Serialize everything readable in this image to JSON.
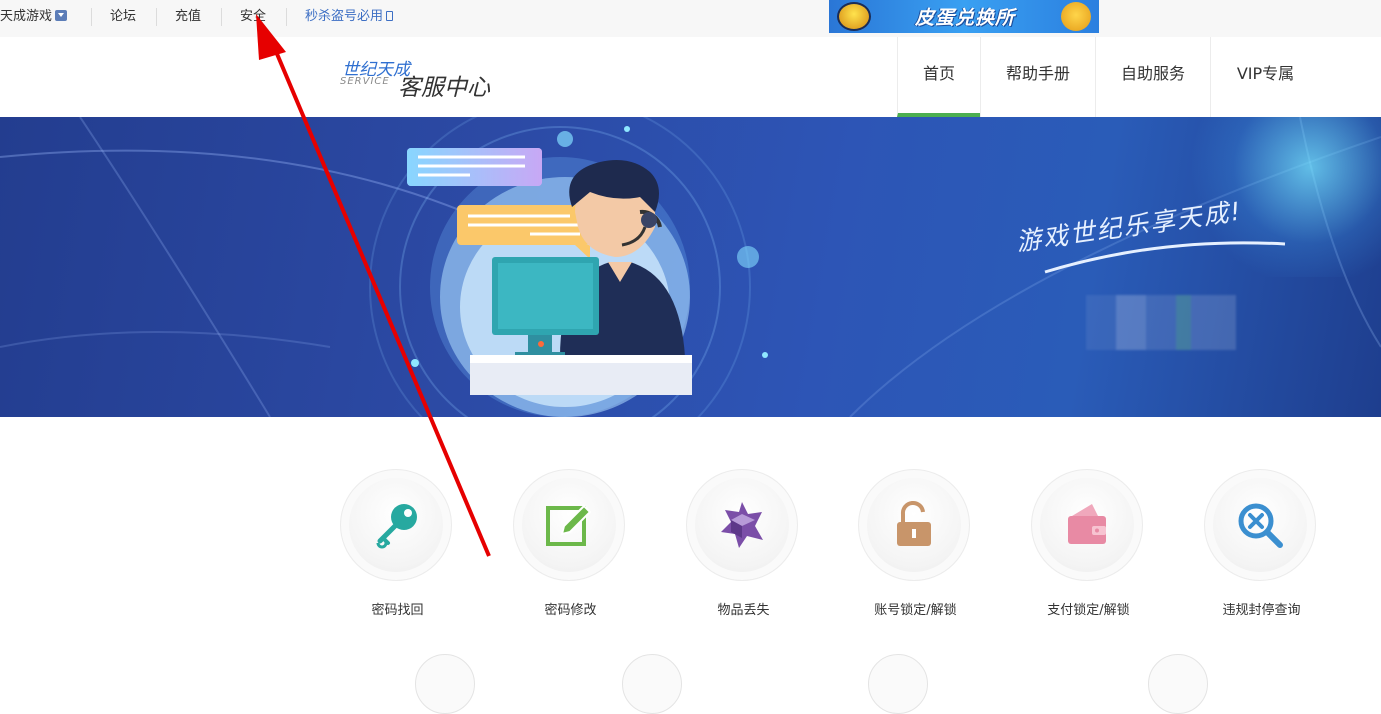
{
  "topbar": {
    "games_menu": "天成游戏",
    "forum": "论坛",
    "recharge": "充值",
    "security": "安全",
    "anti_theft": "秒杀盗号必用"
  },
  "ad_banner": {
    "text": "皮蛋兑换所"
  },
  "header": {
    "logo_brand": "世纪天成",
    "logo_service": "SERVICE",
    "logo_title": "客服中心"
  },
  "nav": {
    "tabs": [
      {
        "label": "首页",
        "active": true
      },
      {
        "label": "帮助手册",
        "active": false
      },
      {
        "label": "自助服务",
        "active": false
      },
      {
        "label": "VIP专属",
        "active": false
      }
    ]
  },
  "hero": {
    "slogan": "游戏世纪乐享天成!"
  },
  "services": {
    "items": [
      {
        "label": "密码找回",
        "icon": "key-icon"
      },
      {
        "label": "密码修改",
        "icon": "edit-icon"
      },
      {
        "label": "物品丢失",
        "icon": "box-icon"
      },
      {
        "label": "账号锁定/解锁",
        "icon": "lock-icon"
      },
      {
        "label": "支付锁定/解锁",
        "icon": "wallet-icon"
      },
      {
        "label": "违规封停查询",
        "icon": "search-ban-icon"
      }
    ]
  },
  "colors": {
    "nav_active_underline": "#4caf50",
    "hero_blue": "#2c4aa5",
    "key_teal": "#27a9a0",
    "edit_green": "#6cb84a",
    "box_purple": "#7b4ea8",
    "lock_tan": "#c8956a",
    "wallet_pink": "#e88aa4",
    "search_blue": "#3b8fd0",
    "annotation_red": "#e60000"
  }
}
